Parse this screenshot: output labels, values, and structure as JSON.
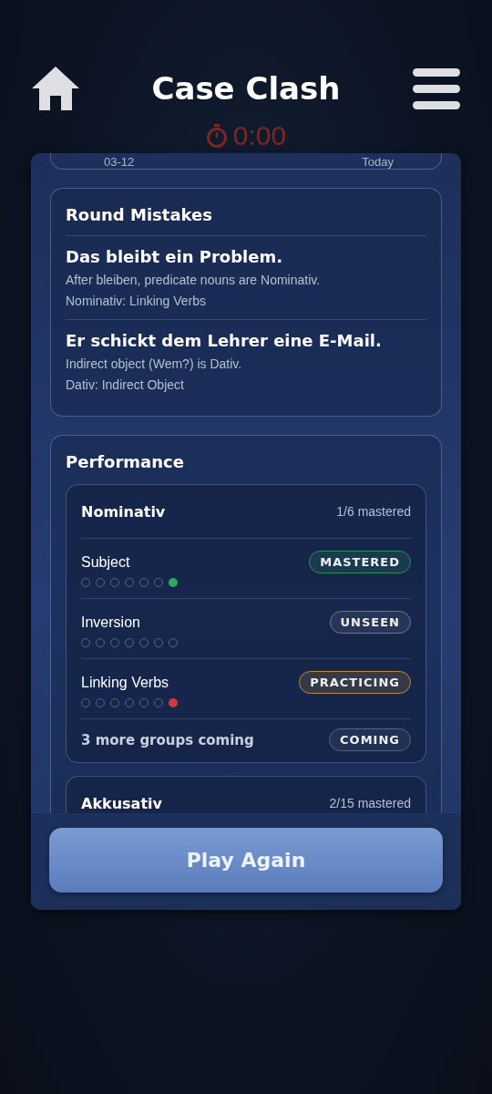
{
  "header": {
    "title": "Case Clash",
    "timer": "0:00"
  },
  "previous_card": {
    "left": "03-12",
    "right": "Today"
  },
  "mistakes": {
    "title": "Round Mistakes",
    "items": [
      {
        "sentence": "Das bleibt ein Problem.",
        "explanation": "After bleiben, predicate nouns are Nominativ.",
        "topic": "Nominativ: Linking Verbs"
      },
      {
        "sentence": "Er schickt dem Lehrer eine E-Mail.",
        "explanation": "Indirect object (Wem?) is Dativ.",
        "topic": "Dativ: Indirect Object"
      }
    ]
  },
  "performance": {
    "title": "Performance",
    "groups": [
      {
        "name": "Nominativ",
        "summary": "1/6 mastered",
        "rows": [
          {
            "kind": "skill",
            "name": "Subject",
            "badge": {
              "label": "MASTERED",
              "color": "#2e8d62"
            },
            "dots": [
              {
                "filled": false
              },
              {
                "filled": false
              },
              {
                "filled": false
              },
              {
                "filled": false
              },
              {
                "filled": false
              },
              {
                "filled": false
              },
              {
                "filled": true,
                "color": "#2fa85b"
              }
            ]
          },
          {
            "kind": "skill",
            "name": "Inversion",
            "badge": {
              "label": "UNSEEN",
              "color": "#6a7690"
            },
            "dots": [
              {
                "filled": false
              },
              {
                "filled": false
              },
              {
                "filled": false
              },
              {
                "filled": false
              },
              {
                "filled": false
              },
              {
                "filled": false
              },
              {
                "filled": false
              }
            ]
          },
          {
            "kind": "skill",
            "name": "Linking Verbs",
            "badge": {
              "label": "PRACTICING",
              "color": "#b98b3c"
            },
            "dots": [
              {
                "filled": false
              },
              {
                "filled": false
              },
              {
                "filled": false
              },
              {
                "filled": false
              },
              {
                "filled": false
              },
              {
                "filled": false
              },
              {
                "filled": true,
                "color": "#d0393f"
              }
            ]
          },
          {
            "kind": "more",
            "name": "3 more groups coming",
            "badge": {
              "label": "COMING",
              "color": "#56627c"
            }
          }
        ]
      },
      {
        "name": "Akkusativ",
        "summary": "2/15 mastered"
      }
    ]
  },
  "play_button": "Play Again"
}
